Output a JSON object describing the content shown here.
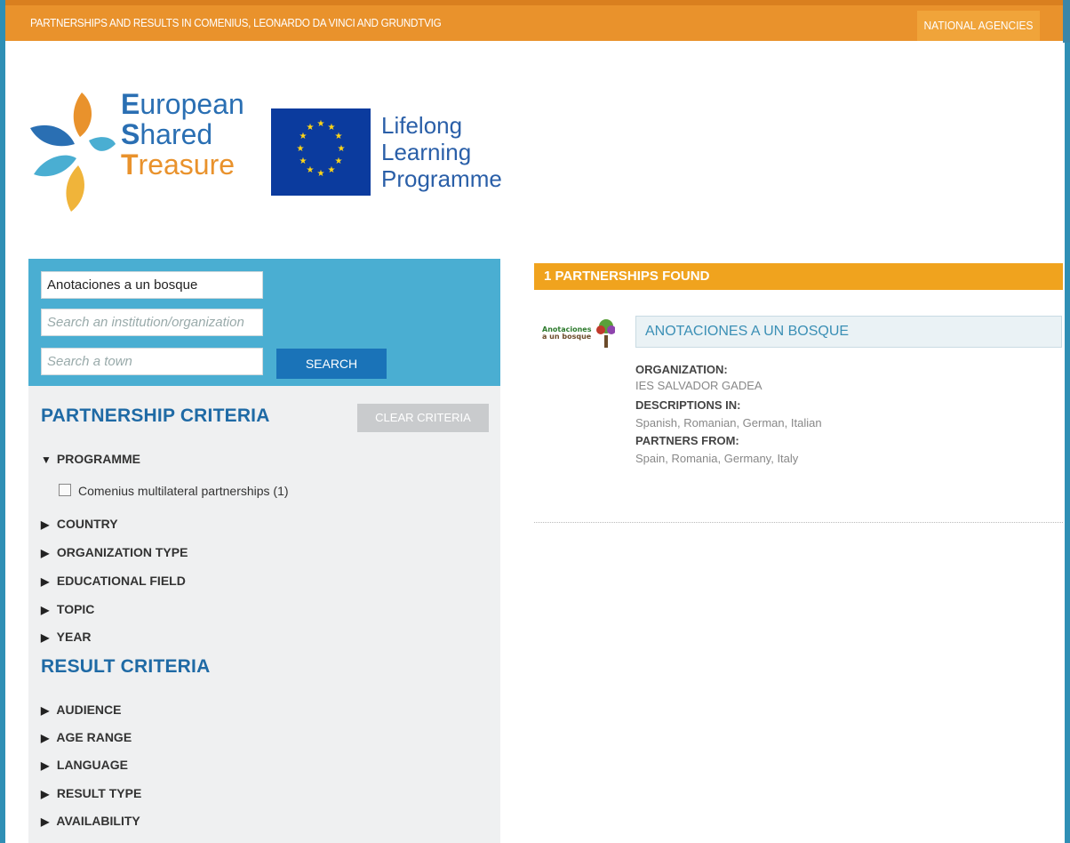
{
  "topbar": {
    "title": "PARTNERSHIPS AND RESULTS IN COMENIUS, LEONARDO DA VINCI AND GRUNDTVIG",
    "national_agencies_label": "NATIONAL AGENCIES"
  },
  "logo_est": {
    "line1_cap": "E",
    "line1_rest": "uropean",
    "line2_cap": "S",
    "line2_rest": "hared",
    "line3_cap": "T",
    "line3_rest": "reasure"
  },
  "logo_llp": {
    "line1": "Lifelong",
    "line2": "Learning",
    "line3": "Programme"
  },
  "search": {
    "query_value": "Anotaciones a un bosque",
    "institution_placeholder": "Search an institution/organization",
    "town_placeholder": "Search a town",
    "search_label": "SEARCH"
  },
  "partnership_criteria": {
    "title": "PARTNERSHIP CRITERIA",
    "clear_label": "CLEAR CRITERIA",
    "programme_label": "PROGRAMME",
    "programme_option": "Comenius multilateral partnerships (1)",
    "country_label": "COUNTRY",
    "org_type_label": "ORGANIZATION TYPE",
    "edu_field_label": "EDUCATIONAL FIELD",
    "topic_label": "TOPIC",
    "year_label": "YEAR"
  },
  "result_criteria": {
    "title": "RESULT CRITERIA",
    "audience_label": "AUDIENCE",
    "age_range_label": "AGE RANGE",
    "language_label": "LANGUAGE",
    "result_type_label": "RESULT TYPE",
    "availability_label": "AVAILABILITY"
  },
  "arrows": {
    "expanded": "▼",
    "collapsed": "▶"
  },
  "results": {
    "header": "1 PARTNERSHIPS FOUND",
    "item": {
      "title": "ANOTACIONES A UN BOSQUE",
      "org_label": "ORGANIZATION:",
      "org_value": "IES SALVADOR GADEA",
      "desc_label": "DESCRIPTIONS IN:",
      "desc_value": "Spanish, Romanian, German, Italian",
      "partners_label": "PARTNERS FROM:",
      "partners_value": "Spain, Romania, Germany, Italy",
      "thumb_text_1": "Anotaciones",
      "thumb_text_2": "a un bosque"
    }
  },
  "colors": {
    "topbar": "#e9922c",
    "search_panel": "#4aaed2",
    "search_button": "#1a73b8",
    "results_header": "#f0a31e",
    "criteria_title": "#1f6aa5"
  }
}
